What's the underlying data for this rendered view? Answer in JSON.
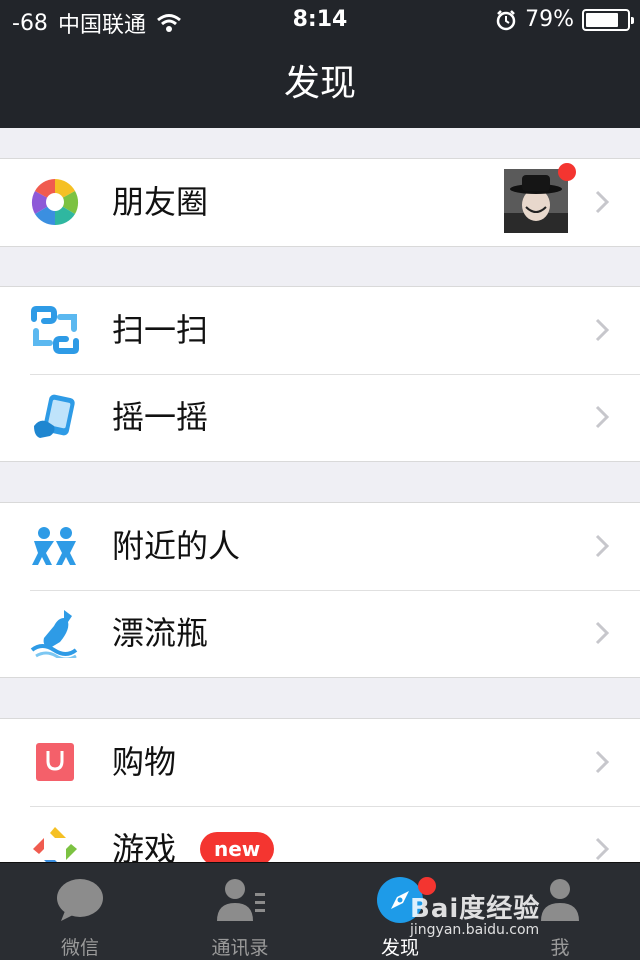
{
  "status_bar": {
    "signal": "-68",
    "carrier": "中国联通",
    "time": "8:14",
    "battery_text": "79%",
    "battery_level": 0.79,
    "icons": [
      "wifi-icon",
      "alarm-icon",
      "battery-icon"
    ]
  },
  "nav": {
    "title": "发现"
  },
  "groups": [
    {
      "items": [
        {
          "label": "朋友圈",
          "icon": "moments-icon",
          "has_avatar": true,
          "has_red_dot": true
        }
      ]
    },
    {
      "items": [
        {
          "label": "扫一扫",
          "icon": "scan-icon"
        },
        {
          "label": "摇一摇",
          "icon": "shake-icon"
        }
      ]
    },
    {
      "items": [
        {
          "label": "附近的人",
          "icon": "people-nearby-icon"
        },
        {
          "label": "漂流瓶",
          "icon": "drift-bottle-icon"
        }
      ]
    },
    {
      "items": [
        {
          "label": "购物",
          "icon": "shopping-icon"
        },
        {
          "label": "游戏",
          "icon": "games-icon",
          "badge": "new"
        }
      ]
    }
  ],
  "tabbar": {
    "tabs": [
      {
        "label": "微信",
        "icon": "chat-bubble-icon",
        "active": false
      },
      {
        "label": "通讯录",
        "icon": "contacts-icon",
        "active": false
      },
      {
        "label": "发现",
        "icon": "compass-icon",
        "active": true
      },
      {
        "label": "我",
        "icon": "me-icon",
        "active": false
      }
    ]
  },
  "watermark": {
    "main": "Bai度经验",
    "sub": "jingyan.baidu.com"
  },
  "colors": {
    "bar_bg": "#22252a",
    "accent_blue": "#1e9be8",
    "badge_red": "#f43530",
    "page_bg": "#efeff4"
  }
}
